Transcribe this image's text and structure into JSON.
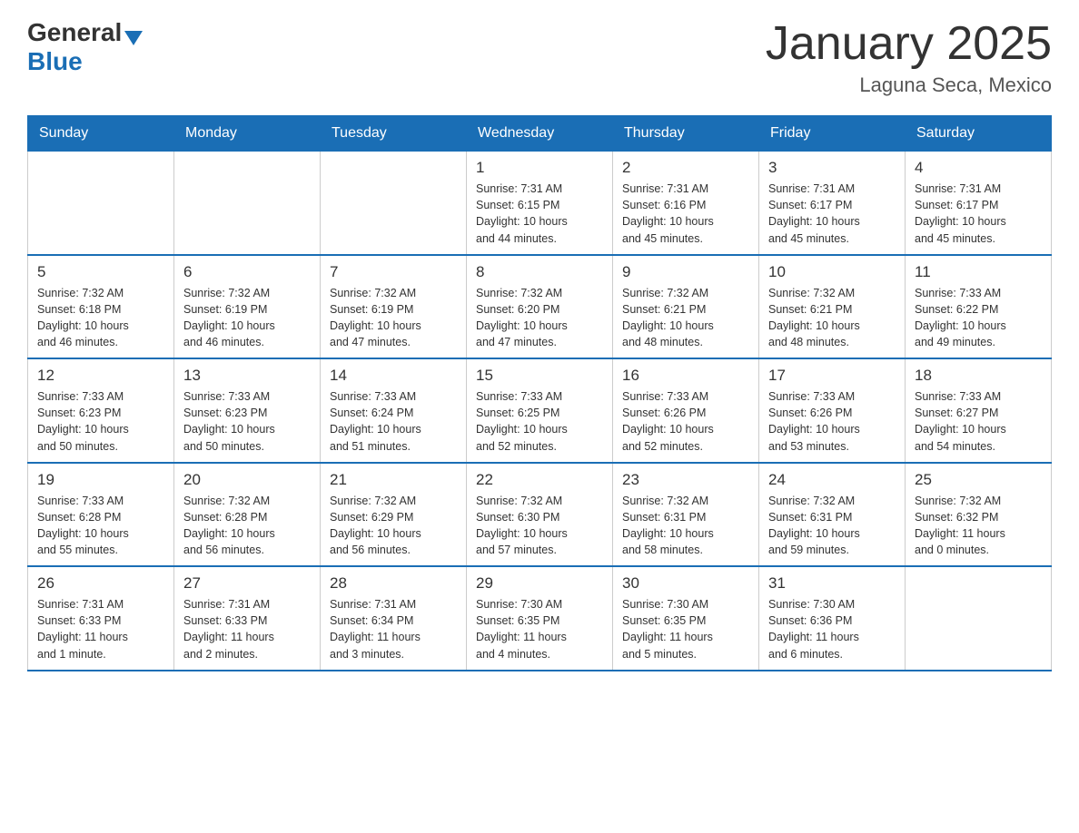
{
  "header": {
    "logo_general": "General",
    "logo_blue": "Blue",
    "title": "January 2025",
    "subtitle": "Laguna Seca, Mexico"
  },
  "days_of_week": [
    "Sunday",
    "Monday",
    "Tuesday",
    "Wednesday",
    "Thursday",
    "Friday",
    "Saturday"
  ],
  "weeks": [
    [
      {
        "day": "",
        "info": ""
      },
      {
        "day": "",
        "info": ""
      },
      {
        "day": "",
        "info": ""
      },
      {
        "day": "1",
        "info": "Sunrise: 7:31 AM\nSunset: 6:15 PM\nDaylight: 10 hours\nand 44 minutes."
      },
      {
        "day": "2",
        "info": "Sunrise: 7:31 AM\nSunset: 6:16 PM\nDaylight: 10 hours\nand 45 minutes."
      },
      {
        "day": "3",
        "info": "Sunrise: 7:31 AM\nSunset: 6:17 PM\nDaylight: 10 hours\nand 45 minutes."
      },
      {
        "day": "4",
        "info": "Sunrise: 7:31 AM\nSunset: 6:17 PM\nDaylight: 10 hours\nand 45 minutes."
      }
    ],
    [
      {
        "day": "5",
        "info": "Sunrise: 7:32 AM\nSunset: 6:18 PM\nDaylight: 10 hours\nand 46 minutes."
      },
      {
        "day": "6",
        "info": "Sunrise: 7:32 AM\nSunset: 6:19 PM\nDaylight: 10 hours\nand 46 minutes."
      },
      {
        "day": "7",
        "info": "Sunrise: 7:32 AM\nSunset: 6:19 PM\nDaylight: 10 hours\nand 47 minutes."
      },
      {
        "day": "8",
        "info": "Sunrise: 7:32 AM\nSunset: 6:20 PM\nDaylight: 10 hours\nand 47 minutes."
      },
      {
        "day": "9",
        "info": "Sunrise: 7:32 AM\nSunset: 6:21 PM\nDaylight: 10 hours\nand 48 minutes."
      },
      {
        "day": "10",
        "info": "Sunrise: 7:32 AM\nSunset: 6:21 PM\nDaylight: 10 hours\nand 48 minutes."
      },
      {
        "day": "11",
        "info": "Sunrise: 7:33 AM\nSunset: 6:22 PM\nDaylight: 10 hours\nand 49 minutes."
      }
    ],
    [
      {
        "day": "12",
        "info": "Sunrise: 7:33 AM\nSunset: 6:23 PM\nDaylight: 10 hours\nand 50 minutes."
      },
      {
        "day": "13",
        "info": "Sunrise: 7:33 AM\nSunset: 6:23 PM\nDaylight: 10 hours\nand 50 minutes."
      },
      {
        "day": "14",
        "info": "Sunrise: 7:33 AM\nSunset: 6:24 PM\nDaylight: 10 hours\nand 51 minutes."
      },
      {
        "day": "15",
        "info": "Sunrise: 7:33 AM\nSunset: 6:25 PM\nDaylight: 10 hours\nand 52 minutes."
      },
      {
        "day": "16",
        "info": "Sunrise: 7:33 AM\nSunset: 6:26 PM\nDaylight: 10 hours\nand 52 minutes."
      },
      {
        "day": "17",
        "info": "Sunrise: 7:33 AM\nSunset: 6:26 PM\nDaylight: 10 hours\nand 53 minutes."
      },
      {
        "day": "18",
        "info": "Sunrise: 7:33 AM\nSunset: 6:27 PM\nDaylight: 10 hours\nand 54 minutes."
      }
    ],
    [
      {
        "day": "19",
        "info": "Sunrise: 7:33 AM\nSunset: 6:28 PM\nDaylight: 10 hours\nand 55 minutes."
      },
      {
        "day": "20",
        "info": "Sunrise: 7:32 AM\nSunset: 6:28 PM\nDaylight: 10 hours\nand 56 minutes."
      },
      {
        "day": "21",
        "info": "Sunrise: 7:32 AM\nSunset: 6:29 PM\nDaylight: 10 hours\nand 56 minutes."
      },
      {
        "day": "22",
        "info": "Sunrise: 7:32 AM\nSunset: 6:30 PM\nDaylight: 10 hours\nand 57 minutes."
      },
      {
        "day": "23",
        "info": "Sunrise: 7:32 AM\nSunset: 6:31 PM\nDaylight: 10 hours\nand 58 minutes."
      },
      {
        "day": "24",
        "info": "Sunrise: 7:32 AM\nSunset: 6:31 PM\nDaylight: 10 hours\nand 59 minutes."
      },
      {
        "day": "25",
        "info": "Sunrise: 7:32 AM\nSunset: 6:32 PM\nDaylight: 11 hours\nand 0 minutes."
      }
    ],
    [
      {
        "day": "26",
        "info": "Sunrise: 7:31 AM\nSunset: 6:33 PM\nDaylight: 11 hours\nand 1 minute."
      },
      {
        "day": "27",
        "info": "Sunrise: 7:31 AM\nSunset: 6:33 PM\nDaylight: 11 hours\nand 2 minutes."
      },
      {
        "day": "28",
        "info": "Sunrise: 7:31 AM\nSunset: 6:34 PM\nDaylight: 11 hours\nand 3 minutes."
      },
      {
        "day": "29",
        "info": "Sunrise: 7:30 AM\nSunset: 6:35 PM\nDaylight: 11 hours\nand 4 minutes."
      },
      {
        "day": "30",
        "info": "Sunrise: 7:30 AM\nSunset: 6:35 PM\nDaylight: 11 hours\nand 5 minutes."
      },
      {
        "day": "31",
        "info": "Sunrise: 7:30 AM\nSunset: 6:36 PM\nDaylight: 11 hours\nand 6 minutes."
      },
      {
        "day": "",
        "info": ""
      }
    ]
  ]
}
